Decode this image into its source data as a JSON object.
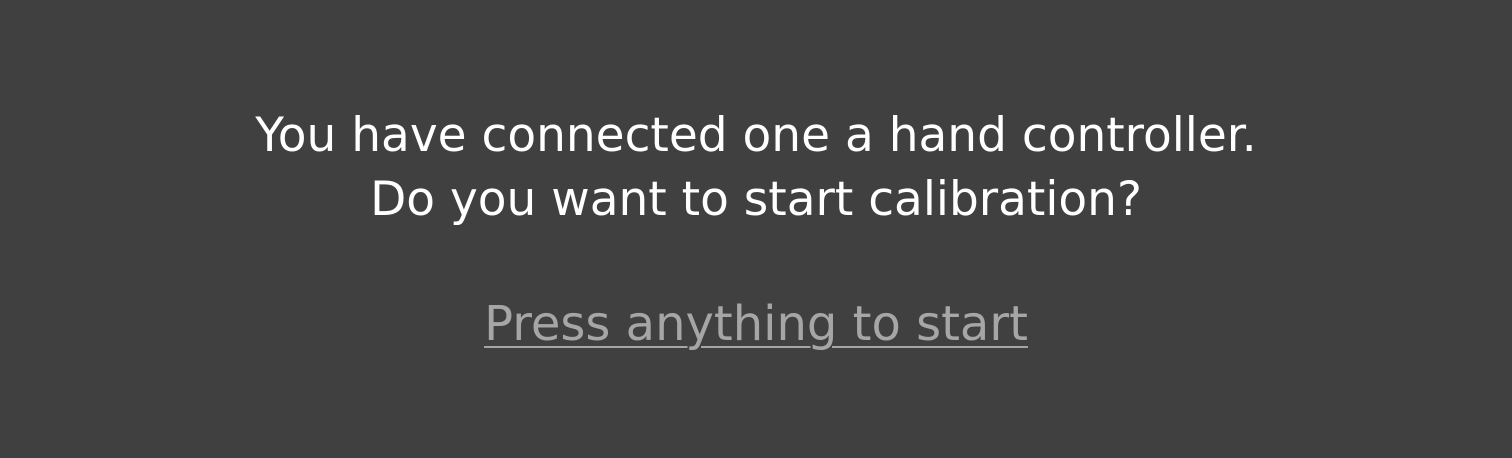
{
  "dialog": {
    "message_line1": "You have connected one a hand controller.",
    "message_line2": "Do you want to start calibration?",
    "start_link_label": "Press anything to start"
  },
  "colors": {
    "background": "#404040",
    "message_text": "#ffffff",
    "link_text": "#a6a6a6"
  }
}
